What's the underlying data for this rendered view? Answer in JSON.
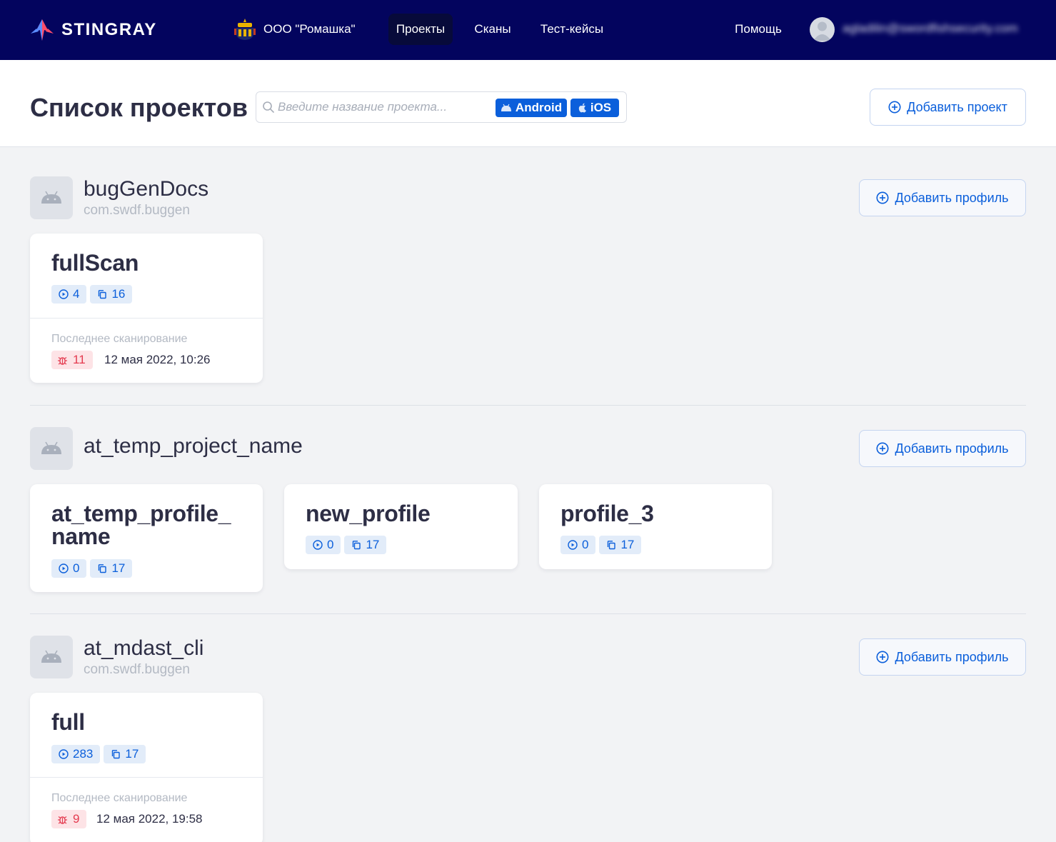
{
  "nav": {
    "logo_text": "STINGRAY",
    "org_name": "ООО \"Ромашка\"",
    "links": {
      "projects": "Проекты",
      "scans": "Сканы",
      "test_cases": "Тест-кейсы",
      "help": "Помощь"
    },
    "user_email": "agladilin@swordfishsecurity.com"
  },
  "header": {
    "title": "Список проектов",
    "search_placeholder": "Введите название проекта...",
    "chip_android": "Android",
    "chip_ios": "iOS",
    "add_project": "Добавить проект"
  },
  "colors": {
    "navbar": "#03045e",
    "accent": "#0b5fdb",
    "bug": "#e43a4f",
    "background": "#f2f3f5"
  },
  "add_profile_label": "Добавить профиль",
  "last_scan_label": "Последнее сканирование",
  "projects": [
    {
      "name": "bugGenDocs",
      "package": "com.swdf.buggen",
      "platform_icon": "android-icon",
      "profiles": [
        {
          "name": "fullScan",
          "scans": "4",
          "test_cases": "16",
          "bugs": "11",
          "last_scan": "12 мая 2022, 10:26"
        }
      ]
    },
    {
      "name": "at_temp_project_name",
      "package": "",
      "platform_icon": "android-icon",
      "profiles": [
        {
          "name": "at_temp_profile_ name",
          "scans": "0",
          "test_cases": "17"
        },
        {
          "name": "new_profile",
          "scans": "0",
          "test_cases": "17"
        },
        {
          "name": "profile_3",
          "scans": "0",
          "test_cases": "17"
        }
      ]
    },
    {
      "name": "at_mdast_cli",
      "package": "com.swdf.buggen",
      "platform_icon": "android-icon",
      "profiles": [
        {
          "name": "full",
          "scans": "283",
          "test_cases": "17",
          "bugs": "9",
          "last_scan": "12 мая 2022, 19:58"
        }
      ]
    }
  ]
}
